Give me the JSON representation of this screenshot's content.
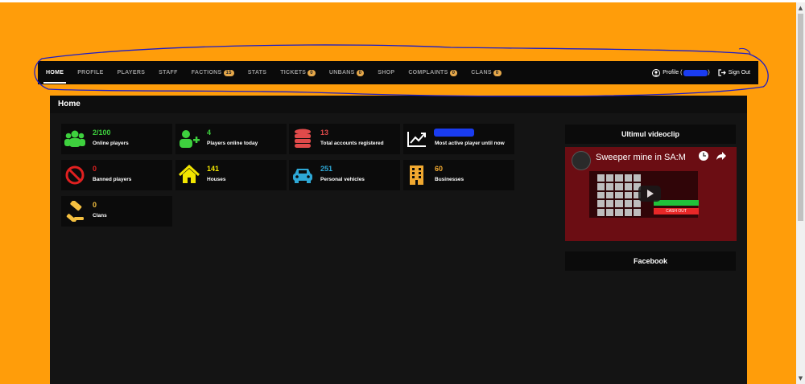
{
  "nav": {
    "items": [
      {
        "label": "HOME"
      },
      {
        "label": "PROFILE"
      },
      {
        "label": "PLAYERS"
      },
      {
        "label": "STAFF"
      },
      {
        "label": "FACTIONS",
        "badge": "15"
      },
      {
        "label": "STATS"
      },
      {
        "label": "TICKETS",
        "badge": "0"
      },
      {
        "label": "UNBANS",
        "badge": "0"
      },
      {
        "label": "SHOP"
      },
      {
        "label": "COMPLAINTS",
        "badge": "0"
      },
      {
        "label": "CLANS",
        "badge": "0"
      }
    ],
    "profile_label": "Profile (",
    "profile_suffix": ")",
    "signout_label": "Sign Out"
  },
  "page": {
    "header": "Home"
  },
  "stats": [
    {
      "value": "2/100",
      "label": "Online players",
      "color": "#3ed13e",
      "icon": "users-icon"
    },
    {
      "value": "4",
      "label": "Players online today",
      "color": "#3ed13e",
      "icon": "user-plus-icon"
    },
    {
      "value": "13",
      "label": "Total accounts registered",
      "color": "#e04a4a",
      "icon": "database-icon"
    },
    {
      "value": "",
      "label": "Most active player until now",
      "color": "#ffffff",
      "icon": "trend-chart-icon"
    },
    {
      "value": "0",
      "label": "Banned players",
      "color": "#e02020",
      "icon": "ban-icon"
    },
    {
      "value": "141",
      "label": "Houses",
      "color": "#f2e600",
      "icon": "home-icon"
    },
    {
      "value": "251",
      "label": "Personal vehicles",
      "color": "#2ea8d6",
      "icon": "car-icon"
    },
    {
      "value": "60",
      "label": "Businesses",
      "color": "#f0a830",
      "icon": "building-icon"
    },
    {
      "value": "0",
      "label": "Clans",
      "color": "#f5c040",
      "icon": "gavel-icon"
    }
  ],
  "sidebar": {
    "video_title": "Ultimul videoclip",
    "video_caption": "Sweeper mine in SA:M",
    "video_button": "CASH OUT",
    "facebook_title": "Facebook"
  },
  "colors": {
    "page_bg": "#ff9d0a",
    "annotation": "#1c1cc8"
  }
}
